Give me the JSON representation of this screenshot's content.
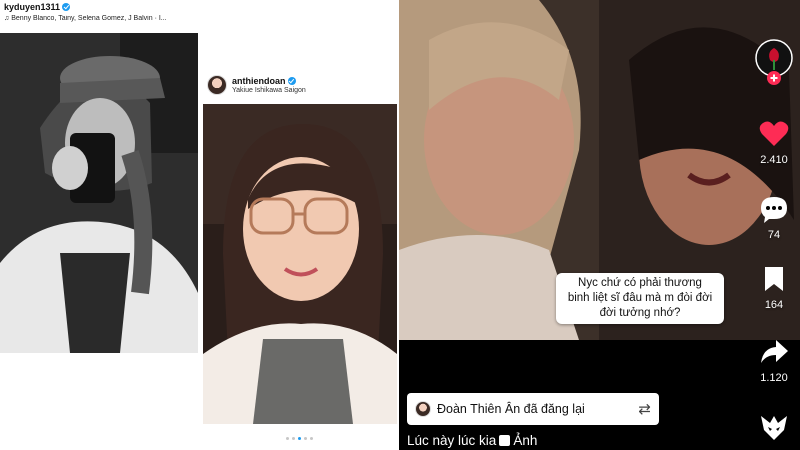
{
  "panel1": {
    "username": "kyduyen1311",
    "music_line": "Benny Blanco, Tainy, Selena Gomez, J Balvin · I..."
  },
  "panel2": {
    "username": "anthiendoan",
    "location": "Yakiue Ishikawa Saigon",
    "carousel_index": 2,
    "carousel_total": 5
  },
  "panel3": {
    "caption_lines": [
      "Nyc chứ có phải thương",
      "binh liệt sĩ đâu mà m đòi đời",
      "đời tưởng nhớ?"
    ],
    "like_count": "2.410",
    "comment_count": "74",
    "save_count": "164",
    "share_count": "1.120",
    "repost_text": "Đoàn Thiên Ân đã đăng lại",
    "description_before": "Lúc này lúc kia",
    "description_after": "Ảnh",
    "accent_color": "#fe2c55"
  }
}
